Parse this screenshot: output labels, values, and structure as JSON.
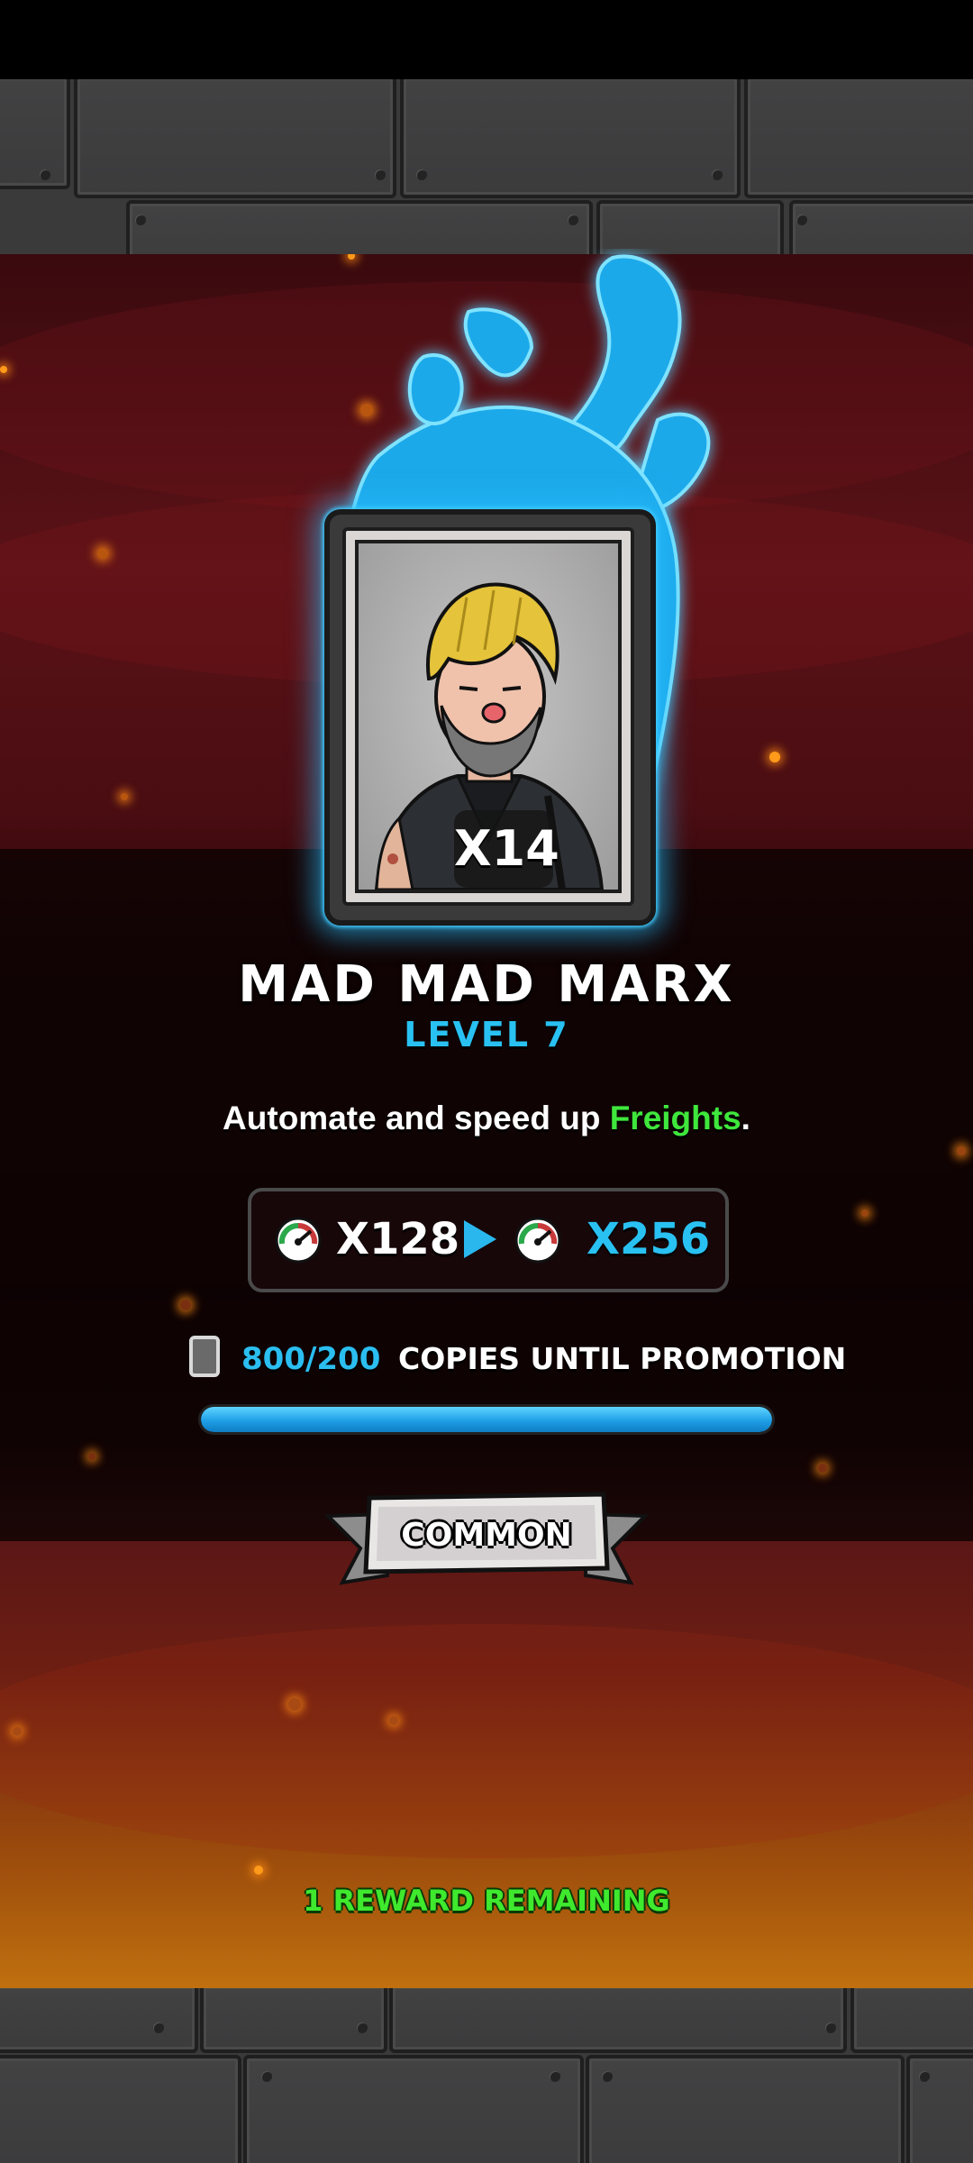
{
  "card": {
    "count": "X14",
    "name": "MAD MAD MARX",
    "level": "LEVEL 7",
    "rarity": "COMMON"
  },
  "description": {
    "prefix": "Automate and speed up ",
    "highlight": "Freights",
    "suffix": "."
  },
  "boost": {
    "current": "X128",
    "next": "X256",
    "icon": "speed-gauge-icon"
  },
  "promotion": {
    "copies": "800/200",
    "label": "COPIES UNTIL PROMOTION",
    "progress": 1.0
  },
  "footer": {
    "rewards_remaining": "1 REWARD REMAINING"
  },
  "colors": {
    "accent_blue": "#29c1f2",
    "highlight_green": "#3fe73c"
  }
}
